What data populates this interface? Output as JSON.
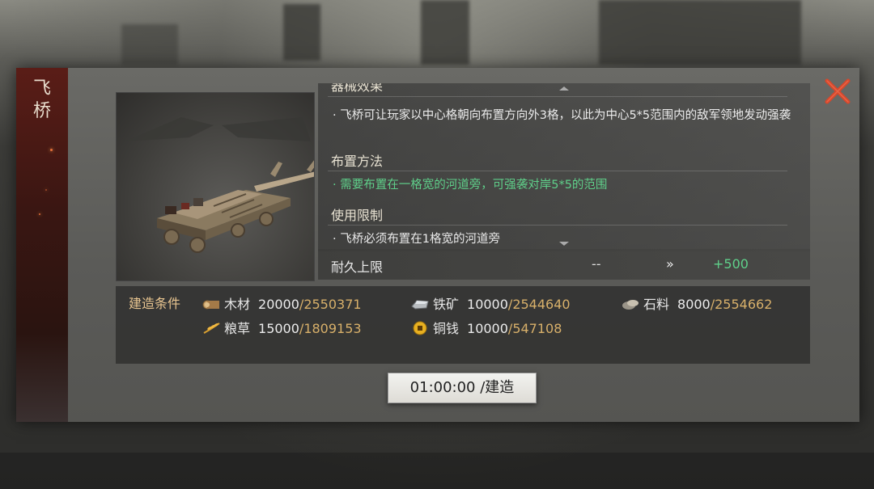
{
  "panel": {
    "title": "飞桥"
  },
  "description": {
    "sections": [
      {
        "heading": "器械效果",
        "text": "· 飞桥可让玩家以中心格朝向布置方向外3格，以此为中心5*5范围内的敌军领地发动强袭"
      },
      {
        "heading": "布置方法",
        "text": "· 需要布置在一格宽的河道旁，可强袭对岸5*5的范围"
      },
      {
        "heading": "使用限制",
        "text": "· 飞桥必须布置在1格宽的河道旁"
      }
    ]
  },
  "durability": {
    "label": "耐久上限",
    "current": "--",
    "arrow": "»",
    "new_value": "+500"
  },
  "conditions": {
    "label": "建造条件",
    "resources": [
      {
        "icon": "wood-icon",
        "name": "木材",
        "need": "20000",
        "have": "/2550371"
      },
      {
        "icon": "iron-ore-icon",
        "name": "铁矿",
        "need": "10000",
        "have": "/2544640"
      },
      {
        "icon": "stone-icon",
        "name": "石料",
        "need": "8000",
        "have": "/2554662"
      },
      {
        "icon": "grain-icon",
        "name": "粮草",
        "need": "15000",
        "have": "/1809153"
      },
      {
        "icon": "copper-coin-icon",
        "name": "铜钱",
        "need": "10000",
        "have": "/547108"
      }
    ]
  },
  "build_button": {
    "label": "01:00:00 /建造"
  },
  "colors": {
    "accent_red": "#d9472b",
    "positive_green": "#5fd08a",
    "resource_owned": "#d8b06a",
    "condition_label": "#e8c590"
  }
}
